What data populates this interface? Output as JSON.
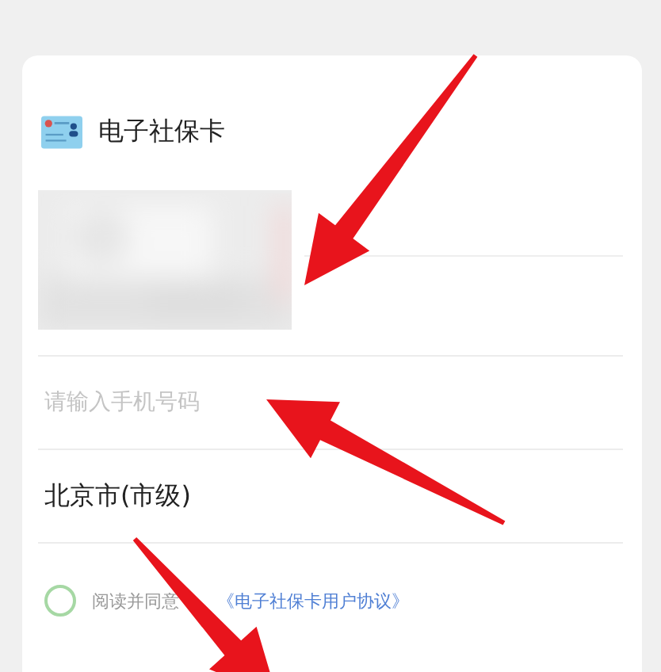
{
  "card": {
    "title": "电子社保卡"
  },
  "phone_field": {
    "placeholder": "请输入手机号码"
  },
  "region": {
    "value": "北京市(市级)"
  },
  "agreement": {
    "checked": false,
    "text": "阅读并同意",
    "link": "《电子社保卡用户协议》"
  },
  "annotations": [
    {
      "kind": "arrow"
    },
    {
      "kind": "arrow"
    },
    {
      "kind": "arrow"
    }
  ]
}
